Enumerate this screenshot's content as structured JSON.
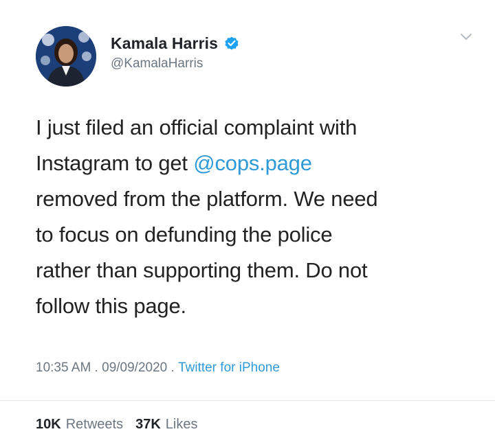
{
  "tweet": {
    "author": {
      "name": "Kamala Harris",
      "handle": "@KamalaHarris",
      "verified": true,
      "avatar_icon": "profile-photo"
    },
    "text": {
      "part1": "I just filed an official complaint with\nInstagram to get ",
      "mention": "@cops.page",
      "part2": "\nremoved from the platform. We need\nto focus on defunding the police\nrather than supporting them. Do not\nfollow this page."
    },
    "meta": {
      "time": "10:35 AM",
      "sep1": " . ",
      "date": "09/09/2020",
      "sep2": " . ",
      "source": "Twitter for iPhone"
    },
    "stats": {
      "retweets_count": "10K",
      "retweets_label": "Retweets",
      "likes_count": "37K",
      "likes_label": "Likes"
    },
    "colors": {
      "link": "#2f9ad8",
      "verified_badge": "#1da1f2",
      "secondary_text": "#6b7680"
    }
  }
}
